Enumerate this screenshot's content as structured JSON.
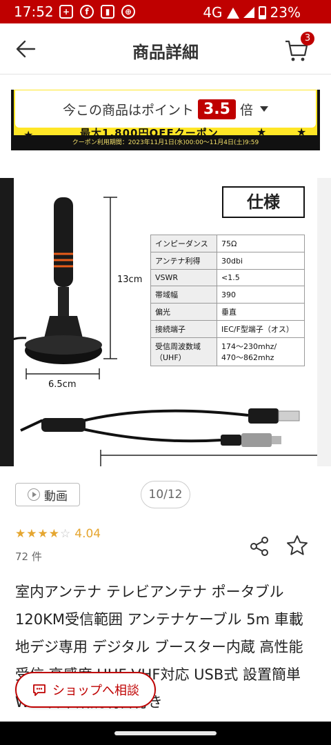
{
  "status_bar": {
    "time": "17:52",
    "network": "4G",
    "battery": "23%",
    "icons": [
      "battery-saver-icon",
      "facebook-icon",
      "sim-icon",
      "globe-icon"
    ]
  },
  "header": {
    "title": "商品詳細",
    "cart_count": "3"
  },
  "points_banner": {
    "prefix": "今この商品はポイント",
    "multiplier": "3.5",
    "suffix": "倍",
    "promo_text": "最大1,800円OFFクーポン",
    "coupon_period": "クーポン利用期間：2023年11月1日(水)00:00〜11月4日(土)9:59"
  },
  "gallery": {
    "spec_title": "仕様",
    "spec_rows": [
      {
        "k": "インピーダンス",
        "v": "75Ω"
      },
      {
        "k": "アンテナ利得",
        "v": "30dbi"
      },
      {
        "k": "VSWR",
        "v": "<1.5"
      },
      {
        "k": "帯域幅",
        "v": "390"
      },
      {
        "k": "偏光",
        "v": "垂直"
      },
      {
        "k": "接続端子",
        "v": "IEC/F型端子（オス）"
      },
      {
        "k": "受信周波数域（UHF）",
        "v": "174〜230mhz/ 470〜862mhz"
      }
    ],
    "height_label": "13cm",
    "width_label": "6.5cm",
    "video_label": "動画",
    "page_counter": "10/12"
  },
  "rating": {
    "value": "4.04",
    "stars_filled": 4,
    "review_count": "72 件"
  },
  "product": {
    "title": "室内アンテナ テレビアンテナ ポータブル 120KM受信範囲 アンテナケーブル 5m 車載 地デジ専用 デジタル ブースター内蔵 高性能受信 高感度 UHF VHF対応 USB式 設置簡単 Web日本語説明書付き"
  },
  "consult": {
    "label": "ショップへ相談"
  },
  "colors": {
    "brand_red": "#bf0000",
    "star_gold": "#e5a630",
    "promo_yellow": "#ffe626"
  }
}
